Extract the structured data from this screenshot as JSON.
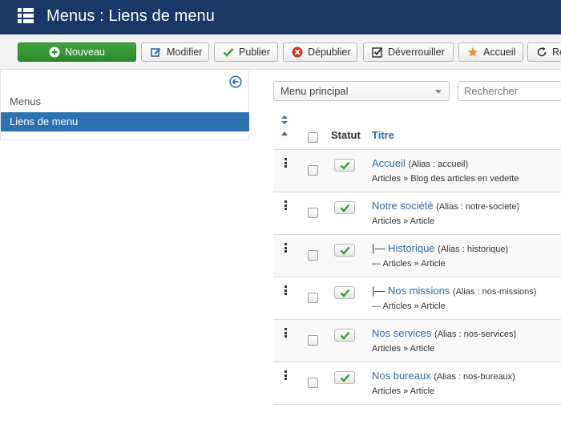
{
  "header": {
    "title": "Menus : Liens de menu",
    "icon": "list-icon"
  },
  "toolbar": {
    "new_label": "Nouveau",
    "edit_label": "Modifier",
    "publish_label": "Publier",
    "unpublish_label": "Dépublier",
    "checkin_label": "Déverrouiller",
    "home_label": "Accueil",
    "rebuild_label": "Re"
  },
  "sidebar": {
    "items": [
      {
        "label": "Menus",
        "active": false
      },
      {
        "label": "Liens de menu",
        "active": true
      }
    ]
  },
  "filters": {
    "menu_selected": "Menu principal",
    "search_placeholder": "Rechercher"
  },
  "table": {
    "columns": {
      "status": "Statut",
      "title": "Titre"
    },
    "rows": [
      {
        "prefix": "",
        "title": "Accueil",
        "alias": "(Alias : accueil)",
        "sub": "Articles » Blog des articles en vedette",
        "published": true
      },
      {
        "prefix": "",
        "title": "Notre société",
        "alias": "(Alias : notre-societe)",
        "sub": "Articles » Article",
        "published": true
      },
      {
        "prefix": "|— ",
        "title": "Historique",
        "alias": "(Alias : historique)",
        "sub": "— Articles » Article",
        "published": true
      },
      {
        "prefix": "|— ",
        "title": "Nos missions",
        "alias": "(Alias : nos-missions)",
        "sub": "— Articles » Article",
        "published": true
      },
      {
        "prefix": "",
        "title": "Nos services",
        "alias": "(Alias : nos-services)",
        "sub": "Articles » Article",
        "published": true
      },
      {
        "prefix": "",
        "title": "Nos bureaux",
        "alias": "(Alias : nos-bureaux)",
        "sub": "Articles » Article",
        "published": true
      }
    ]
  },
  "colors": {
    "header_bg": "#1a3867",
    "new_button": "#3ea33e",
    "sidebar_active": "#2e71b2",
    "link": "#2e6aa7",
    "check_green": "#3a9d3a"
  }
}
